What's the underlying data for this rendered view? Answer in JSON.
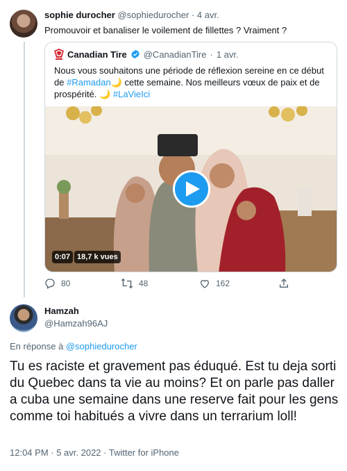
{
  "tweet": {
    "author_name": "sophie durocher",
    "author_handle": "@sophiedurocher",
    "separator": "·",
    "time": "4 avr.",
    "text": "Promouvoir et banaliser le voilement de fillettes ? Vraiment ?",
    "quote": {
      "author_name": "Canadian Tire",
      "author_handle": "@CanadianTire",
      "separator": "·",
      "time": "1 avr.",
      "text_1": "Nous vous souhaitons une période de réflexion sereine en ce début de",
      "hashtag_ramadan": "#Ramadan",
      "crescent_1": "🌙",
      "text_2": " cette semaine. Nos meilleurs vœux de paix et de prospérité. ",
      "crescent_2": "🌙",
      "hashtag_lavielci": "#LaVieIci",
      "video": {
        "duration": "0:07",
        "views": "18,7 k vues",
        "play_icon": "play-icon"
      }
    },
    "actions": {
      "replies": "80",
      "retweets": "48",
      "likes": "162",
      "reply_icon": "reply-icon",
      "retweet_icon": "retweet-icon",
      "like_icon": "heart-icon",
      "share_icon": "share-icon"
    }
  },
  "reply": {
    "author_name": "Hamzah",
    "author_handle": "@Hamzah96AJ",
    "in_reply_prefix": "En réponse à ",
    "in_reply_mention": "@sophiedurocher",
    "text": "Tu es raciste et gravement pas éduqué. Est tu deja sorti du Quebec dans ta vie au moins? Et on parle pas daller a cuba une semaine dans une reserve fait pour les gens comme toi habitués a vivre dans un terrarium loll!",
    "meta": "12:04 PM · 5 avr. 2022 · Twitter for iPhone"
  },
  "colors": {
    "accent": "#1d9bf0",
    "text_primary": "#0f1419",
    "text_secondary": "#536471",
    "border": "#cfd9de",
    "brand_red": "#d2232a"
  }
}
